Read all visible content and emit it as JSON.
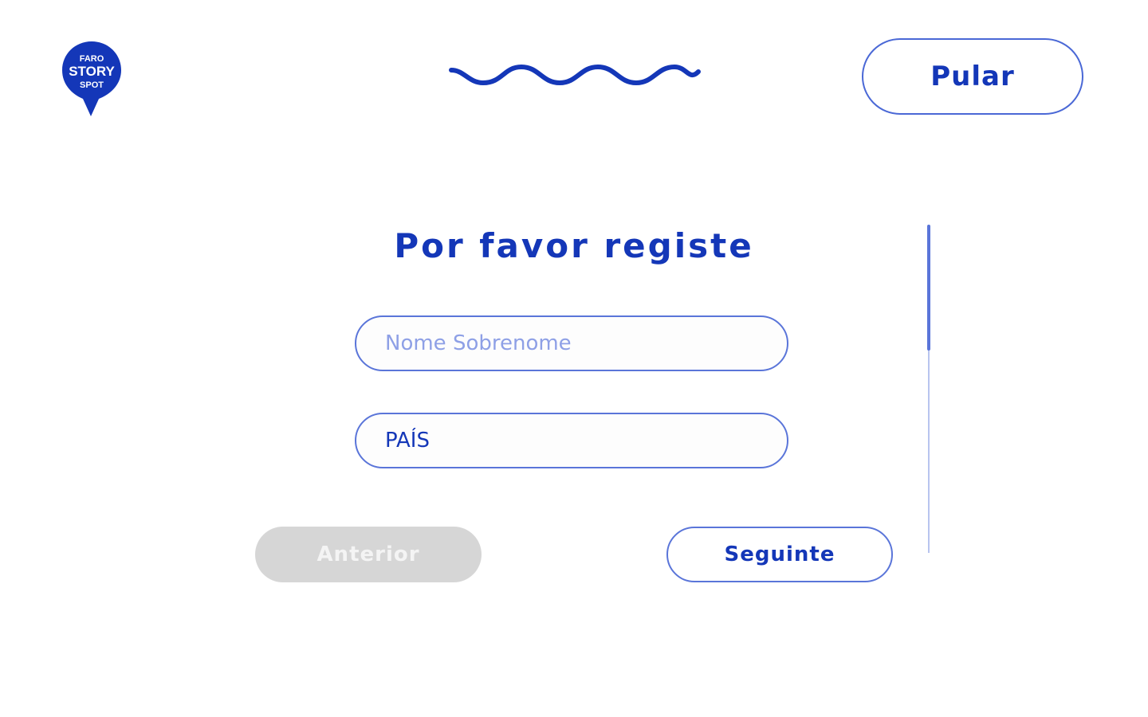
{
  "header": {
    "logo": {
      "icon": "faro-story-spot-logo",
      "lines": [
        "FARO",
        "STORY",
        "SPOT"
      ],
      "color": "#1437b8"
    },
    "decoration": "wave-line",
    "skip_label": "Pular"
  },
  "form": {
    "title": "Por favor registe",
    "name_field": {
      "placeholder": "Nome Sobrenome",
      "value": ""
    },
    "country_field": {
      "value": "PAÍS"
    }
  },
  "navigation": {
    "prev_label": "Anterior",
    "prev_enabled": false,
    "next_label": "Seguinte"
  },
  "colors": {
    "accent": "#1437b8",
    "border": "#5a75d9",
    "disabled": "#d6d6d6"
  }
}
